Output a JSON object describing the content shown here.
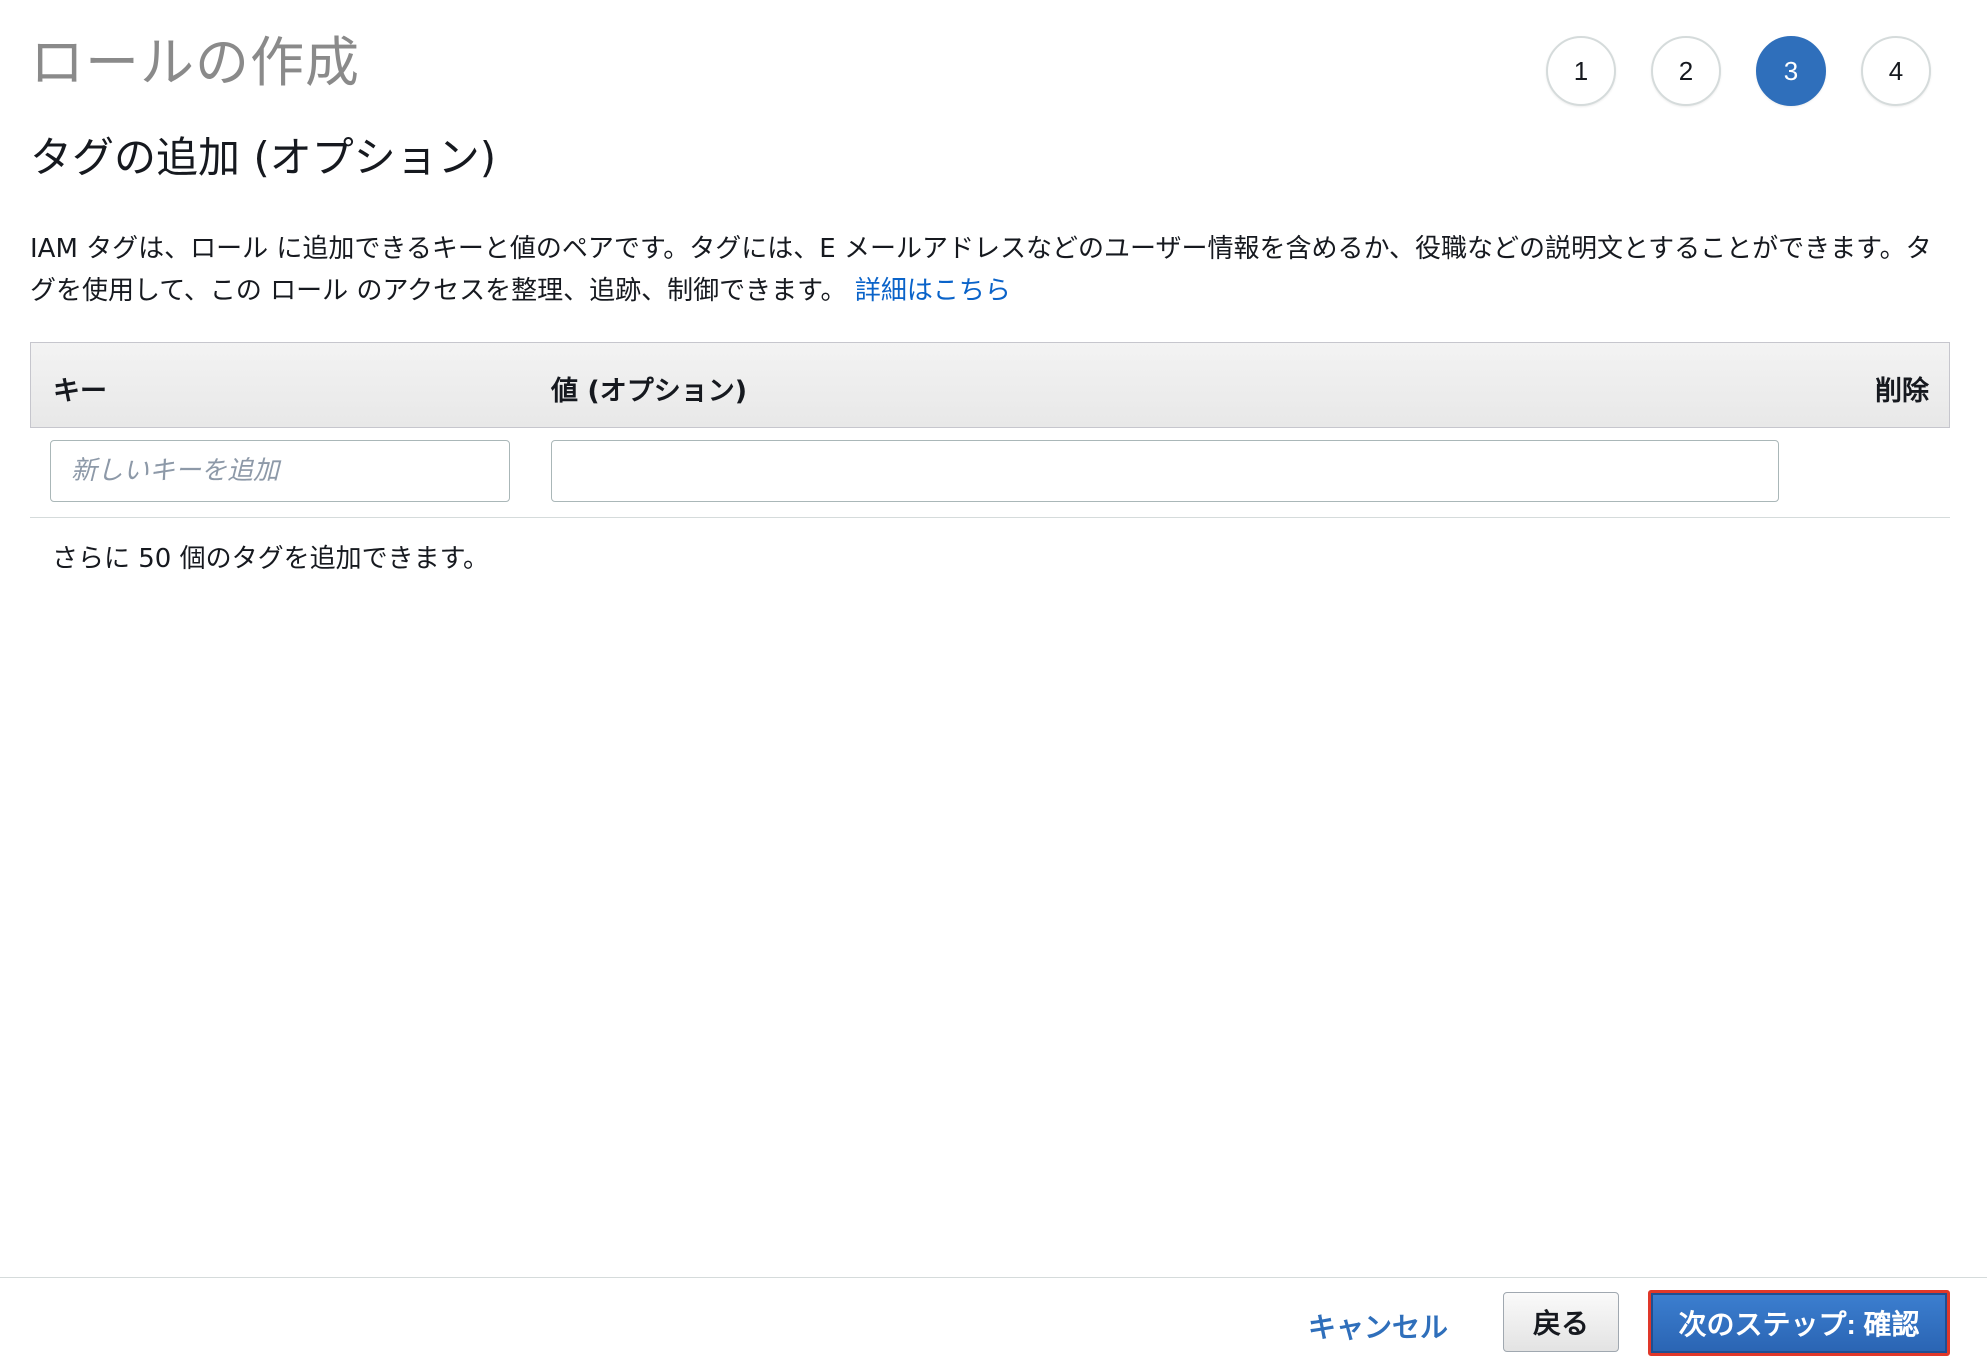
{
  "wizard": {
    "title": "ロールの作成",
    "steps": [
      "1",
      "2",
      "3",
      "4"
    ],
    "active_step": 3
  },
  "section": {
    "title": "タグの追加 (オプション)",
    "description": "IAM タグは、ロール に追加できるキーと値のペアです。タグには、E メールアドレスなどのユーザー情報を含めるか、役職などの説明文とすることができます。タグを使用して、この ロール のアクセスを整理、追跡、制御できます。",
    "learn_more": "詳細はこちら"
  },
  "table": {
    "header_key": "キー",
    "header_value": "値 (オプション)",
    "header_delete": "削除",
    "key_placeholder": "新しいキーを追加",
    "key_value": "",
    "value_value": ""
  },
  "remaining_text": "さらに 50 個のタグを追加できます。",
  "footer": {
    "cancel": "キャンセル",
    "back": "戻る",
    "next": "次のステップ: 確認"
  },
  "colors": {
    "primary": "#2f6fbb",
    "link": "#0a63c9",
    "highlight": "#e0382a"
  }
}
